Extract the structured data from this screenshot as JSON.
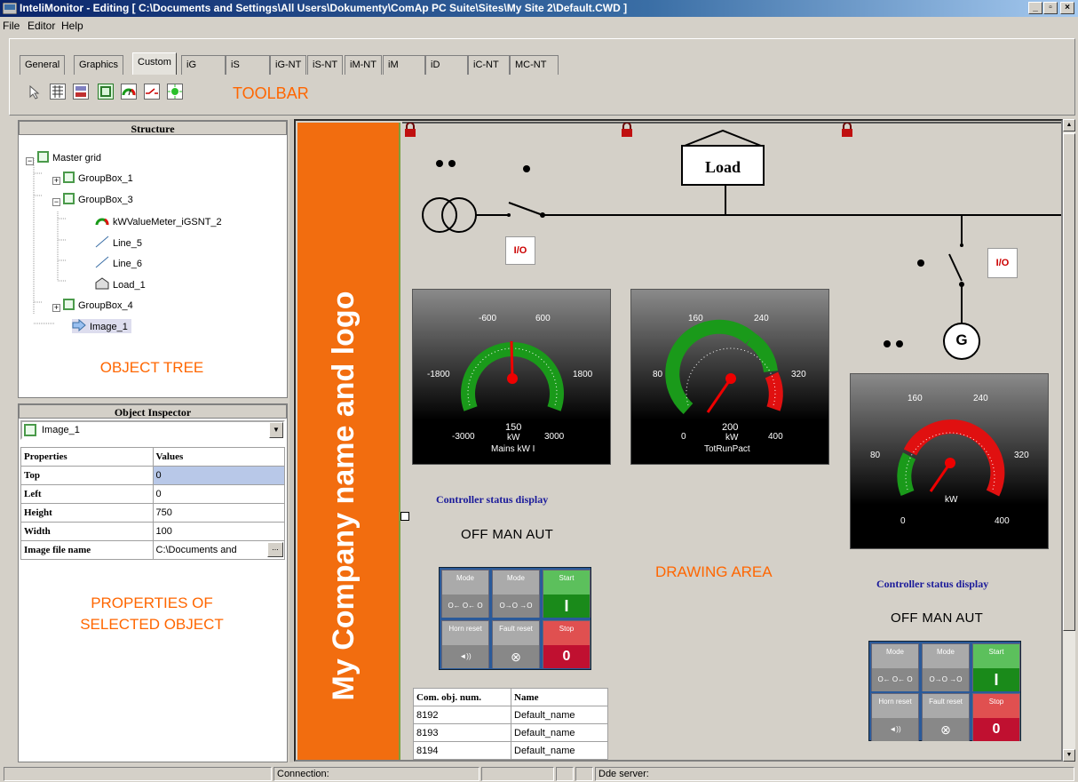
{
  "window": {
    "title": "InteliMonitor - Editing [ C:\\Documents and Settings\\All Users\\Dokumenty\\ComAp PC Suite\\Sites\\My Site 2\\Default.CWD ]"
  },
  "menu": [
    "File",
    "Editor",
    "Help"
  ],
  "tabs": [
    "General",
    "Graphics",
    "Custom",
    "iG",
    "iS",
    "iG-NT",
    "iS-NT",
    "iM-NT",
    "iM",
    "iD",
    "iC-NT",
    "MC-NT"
  ],
  "toolbar": {
    "label": "TOOLBAR"
  },
  "structure": {
    "header": "Structure",
    "nodes": [
      "Master grid",
      "GroupBox_1",
      "GroupBox_3",
      "kWValueMeter_iGSNT_2",
      "Line_5",
      "Line_6",
      "Load_1",
      "GroupBox_4",
      "Image_1"
    ],
    "label": "OBJECT TREE"
  },
  "inspector": {
    "header": "Object Inspector",
    "selected": "Image_1",
    "col_props": "Properties",
    "col_values": "Values",
    "rows": [
      {
        "k": "Top",
        "v": "0"
      },
      {
        "k": "Left",
        "v": "0"
      },
      {
        "k": "Height",
        "v": "750"
      },
      {
        "k": "Width",
        "v": "100"
      },
      {
        "k": "Image file name",
        "v": "C:\\Documents and"
      }
    ],
    "ellipsis": "...",
    "label1": "PROPERTIES OF",
    "label2": "SELECTED OBJECT"
  },
  "drawing": {
    "company": "My Company name and logo",
    "load": "Load",
    "gen": "G",
    "io": "I/O",
    "label": "DRAWING AREA",
    "gauge1": {
      "ticks": [
        "-600",
        "600",
        "-1800",
        "1800",
        "-3000",
        "3000"
      ],
      "value": "150",
      "unit": "kW",
      "name": "Mains kW I"
    },
    "gauge2": {
      "ticks": [
        "160",
        "240",
        "80",
        "320",
        "0",
        "400"
      ],
      "value": "200",
      "unit": "kW",
      "name": "TotRunPact"
    },
    "gauge3": {
      "ticks": [
        "160",
        "240",
        "80",
        "320",
        "0",
        "400"
      ],
      "unit": "kW"
    },
    "ctrl_title": "Controller status display",
    "ctrl_status": "OFF MAN AUT",
    "buttons": {
      "mode": "Mode",
      "start": "Start",
      "start_val": "I",
      "horn": "Horn reset",
      "fault": "Fault reset",
      "stop": "Stop",
      "stop_val": "0",
      "mode_seq1": "O← O← O",
      "mode_seq2": "O→O →O"
    },
    "table": {
      "headers": [
        "Com. obj. num.",
        "Name"
      ],
      "rows": [
        [
          "8192",
          "Default_name"
        ],
        [
          "8193",
          "Default_name"
        ],
        [
          "8194",
          "Default_name"
        ]
      ]
    }
  },
  "status": {
    "connection": "Connection:",
    "dde": "Dde server:"
  },
  "colors": {
    "accent": "#ff6600",
    "title_bar": "#0a246a",
    "gauge_green": "#1a9a1a",
    "gauge_red": "#e01010"
  }
}
